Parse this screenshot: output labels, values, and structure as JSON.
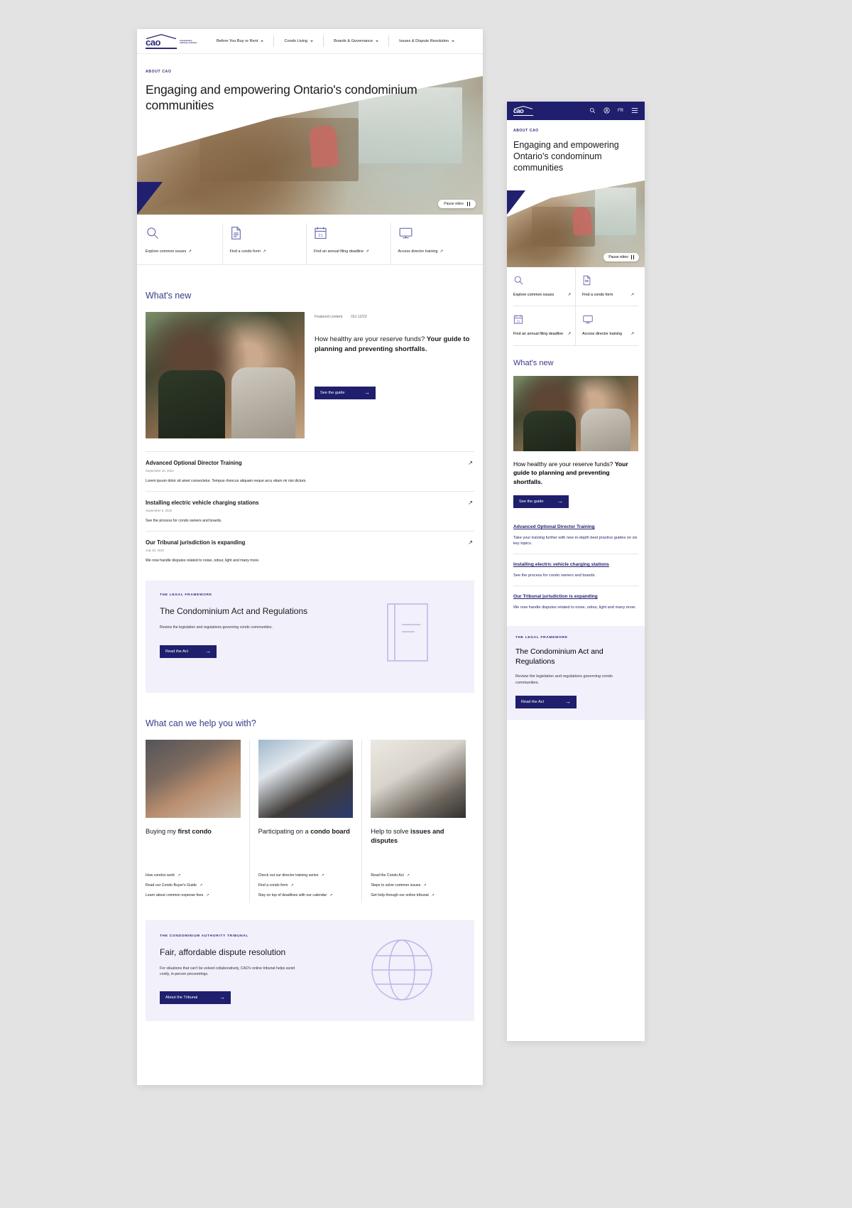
{
  "nav": {
    "logo": {
      "text": "cao",
      "sub": "Condominium Authority of Ontario"
    },
    "items": [
      {
        "label": "Before You Buy or Rent",
        "icon": "chevron-down-icon"
      },
      {
        "label": "Condo Living",
        "icon": "chevron-down-icon"
      },
      {
        "label": "Boards & Governance",
        "icon": "chevron-down-icon"
      },
      {
        "label": "Issues & Dispute Resolution",
        "icon": "chevron-down-icon"
      }
    ]
  },
  "hero": {
    "kicker": "ABOUT CAO",
    "title": "Engaging and empowering Ontario's condominium communities",
    "title_mobile": "Engaging and empowering Ontario's condominum communities",
    "pause_label": "Pause video"
  },
  "quick_links": [
    {
      "label": "Explore common issues",
      "icon": "search-icon",
      "arrow": "↗"
    },
    {
      "label": "Find a condo form",
      "icon": "document-icon",
      "arrow": "↗"
    },
    {
      "label": "Find an annual filing deadline",
      "icon": "calendar-icon",
      "arrow": "↗"
    },
    {
      "label": "Access director training",
      "icon": "monitor-icon",
      "arrow": "↗"
    }
  ],
  "quick_links_mobile": [
    {
      "label": "Explore common issues",
      "icon": "search-icon",
      "arrow": "↗"
    },
    {
      "label": "Find a condo form",
      "icon": "document-icon",
      "arrow": "↗"
    },
    {
      "label": "Find an annual filing deadline",
      "icon": "calendar-icon",
      "arrow": "↗"
    },
    {
      "label": "Access director training",
      "icon": "monitor-icon",
      "arrow": "↗"
    }
  ],
  "whats_new": {
    "title": "What's new",
    "featured": {
      "meta_type": "Featured content",
      "meta_date": "Oct 12/22",
      "headline_lead": "How healthy are your reserve funds? ",
      "headline_bold": "Your guide to planning and preventing shortfalls.",
      "headline_mobile_lead": "How healthy are your reserve funds? ",
      "headline_mobile_bold": "Your guide to planning and preventing shortfalls.",
      "cta_label": "See the guide",
      "cta_arrow": "→"
    },
    "articles": [
      {
        "title": "Advanced Optional Director Training",
        "date": "September 10, 2022",
        "desc": "Lorem ipsum dolor sit amet consectetur. Tempus rhoncus aliquam neque arcu etiam mi nisi dictum.",
        "desc_mobile": "Take your training further with new in-depth best practice guides on six key topics.",
        "arrow": "↗"
      },
      {
        "title": "Installing electric vehicle charging stations",
        "date": "September 6, 2022",
        "desc": "See the process for condo owners and boards.",
        "desc_mobile": "See the process for condo owners and boards.",
        "arrow": "↗"
      },
      {
        "title": "Our Tribunal jurisdiction is expanding",
        "date": "July 30, 2022",
        "desc": "We now handle disputes related to noise, odour, light and many more.",
        "desc_mobile": "We now handle disputes related to noise, odour, light and many more.",
        "arrow": "↗"
      }
    ]
  },
  "legal_card": {
    "kicker": "THE LEGAL FRAMEWORK",
    "title": "The Condominium Act and Regulations",
    "desc": "Review the legislation and regulations governing condo communities.",
    "cta_label": "Read the Act",
    "cta_arrow": "→",
    "icon": "book-icon"
  },
  "help": {
    "title": "What can we help you with?",
    "cards": [
      {
        "title_lead": "Buying my ",
        "title_bold": "first condo",
        "image": "woman-packing-moving-box-photo",
        "links": [
          {
            "label": "How condos work",
            "arrow": "↗"
          },
          {
            "label": "Read our Condo Buyer's Guide",
            "arrow": "↗"
          },
          {
            "label": "Learn about common expense fees",
            "arrow": "↗"
          }
        ]
      },
      {
        "title_lead": "Participating on a ",
        "title_bold": "condo board",
        "image": "woman-at-board-meeting-photo",
        "links": [
          {
            "label": "Check out our director training series",
            "arrow": "↗"
          },
          {
            "label": "Find a condo form",
            "arrow": "↗"
          },
          {
            "label": "Stay on top of deadlines with our calendar",
            "arrow": "↗"
          }
        ]
      },
      {
        "title_lead": "Help to solve ",
        "title_bold": "issues and disputes",
        "image": "chess-pieces-shadow-photo",
        "links": [
          {
            "label": "Read the Condo Act",
            "arrow": "↗"
          },
          {
            "label": "Steps to solve common issues",
            "arrow": "↗"
          },
          {
            "label": "Get help through our online tribunal",
            "arrow": "↗"
          }
        ]
      }
    ]
  },
  "tribunal_card": {
    "kicker": "THE CONDOMINIUM AUTHORITY TRIBUNAL",
    "title": "Fair, affordable dispute resolution",
    "desc": "For situations that can't be solved collaboratively, CAO's online tribunal helps avoid costly, in-person proceedings.",
    "cta_label": "About the Tribunal",
    "cta_arrow": "→",
    "icon": "globe-icon"
  },
  "mobile_nav": {
    "icons": [
      {
        "name": "search-icon"
      },
      {
        "name": "account-icon"
      },
      {
        "name": "hamburger-menu-icon"
      }
    ],
    "lang_label": "FR"
  },
  "colors": {
    "brand_navy": "#1f1f6e",
    "heading_purple": "#3a3a8c",
    "card_lavender": "#f1f0fb",
    "page_bg": "#e3e3e3"
  }
}
